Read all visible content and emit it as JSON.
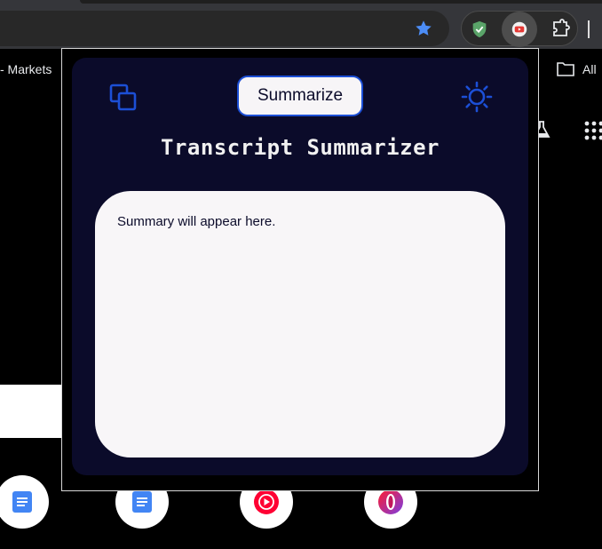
{
  "browser": {
    "bookmarks": {
      "markets_label": "- Markets",
      "all_label": "All"
    },
    "icons": {
      "star": "star-icon",
      "shield": "shield-check-icon",
      "youtube_ext": "youtube-icon",
      "extensions": "puzzle-icon"
    }
  },
  "popup": {
    "summarize_label": "Summarize",
    "title": "Transcript Summarizer",
    "summary_placeholder": "Summary will appear here.",
    "accent_color": "#1c4fd6",
    "panel_color": "#0b0b2a"
  },
  "shortcuts": [
    {
      "icon": "docs-icon"
    },
    {
      "icon": "docs-icon"
    },
    {
      "icon": "youtube-music-icon"
    },
    {
      "icon": "opera-icon"
    }
  ]
}
